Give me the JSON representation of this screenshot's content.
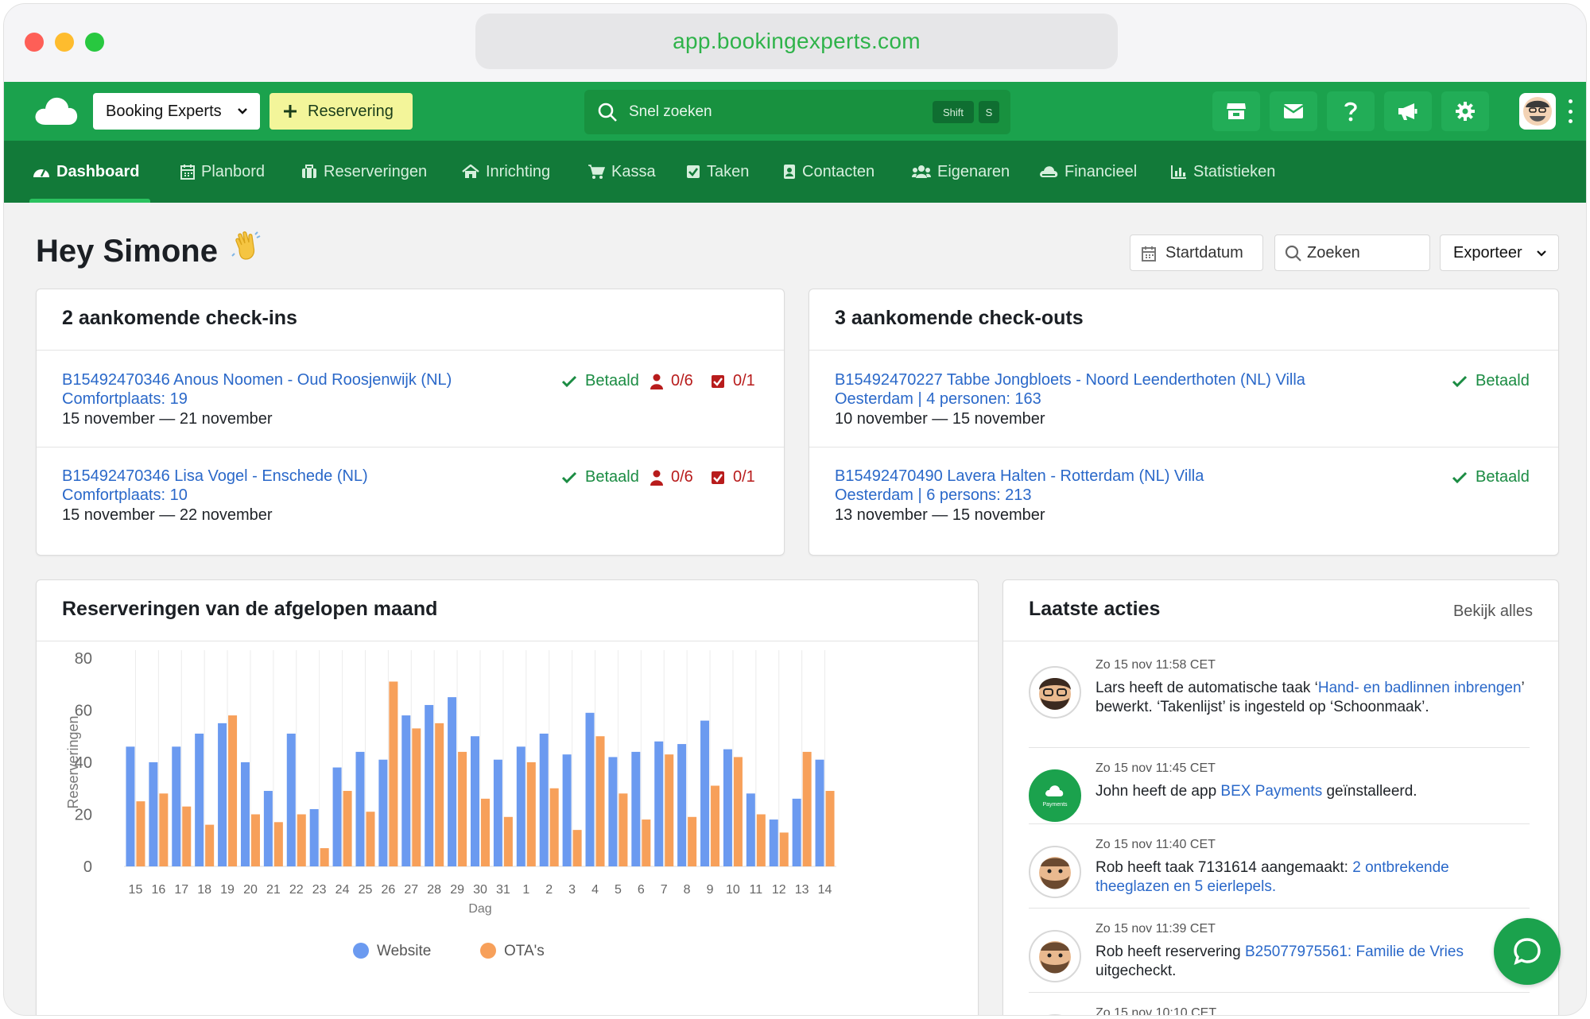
{
  "browser": {
    "url": "app.bookingexperts.com"
  },
  "topbar": {
    "account": "Booking Experts",
    "new_button": "Reservering",
    "search_placeholder": "Snel zoeken",
    "shortcut_keys": [
      "Shift",
      "S"
    ],
    "icons": [
      "store-icon",
      "envelope-icon",
      "question-icon",
      "megaphone-icon",
      "gear-icon"
    ]
  },
  "nav": {
    "items": [
      {
        "label": "Dashboard",
        "icon": "dashboard-icon",
        "active": true
      },
      {
        "label": "Planbord",
        "icon": "calendar-icon"
      },
      {
        "label": "Reserveringen",
        "icon": "suitcase-icon"
      },
      {
        "label": "Inrichting",
        "icon": "home-icon"
      },
      {
        "label": "Kassa",
        "icon": "cart-icon"
      },
      {
        "label": "Taken",
        "icon": "checkbox-icon"
      },
      {
        "label": "Contacten",
        "icon": "contact-card-icon"
      },
      {
        "label": "Eigenaren",
        "icon": "users-icon"
      },
      {
        "label": "Financieel",
        "icon": "cloud-icon"
      },
      {
        "label": "Statistieken",
        "icon": "bar-chart-icon"
      }
    ]
  },
  "header": {
    "greeting": "Hey Simone",
    "date_button": "Startdatum",
    "search_placeholder": "Zoeken",
    "export_button": "Exporteer"
  },
  "checkins": {
    "title": "2 aankomende check-ins",
    "rows": [
      {
        "link": "B15492470346 Anous Noomen - Oud Roosjenwijk (NL) Comfortplaats: 19",
        "dates": "15 november — 21 november",
        "status": "Betaald",
        "guests": "0/6",
        "tasks": "0/1"
      },
      {
        "link": "B15492470346 Lisa Vogel - Enschede (NL) Comfortplaats: 10",
        "dates": "15 november — 22 november",
        "status": "Betaald",
        "guests": "0/6",
        "tasks": "0/1"
      }
    ]
  },
  "checkouts": {
    "title": "3 aankomende check-outs",
    "rows": [
      {
        "link": "B15492470227 Tabbe Jongbloets - Noord Leenderthoten (NL) Villa Oesterdam | 4 personen: 163",
        "dates": "10 november — 15 november",
        "status": "Betaald"
      },
      {
        "link": "B15492470490 Lavera Halten - Rotterdam (NL) Villa Oesterdam | 6 persons: 213",
        "dates": "13 november — 15 november",
        "status": "Betaald"
      }
    ]
  },
  "chart_card": {
    "title": "Reserveringen van de afgelopen maand"
  },
  "chart_data": {
    "type": "bar",
    "xlabel": "Dag",
    "ylabel": "Reserveringen",
    "ylim": [
      0,
      80
    ],
    "yticks": [
      0,
      20,
      40,
      60,
      80
    ],
    "grid": true,
    "legend": "bottom",
    "categories": [
      "15",
      "16",
      "17",
      "18",
      "19",
      "20",
      "21",
      "22",
      "23",
      "24",
      "25",
      "26",
      "27",
      "28",
      "29",
      "30",
      "31",
      "1",
      "2",
      "3",
      "4",
      "5",
      "6",
      "7",
      "8",
      "9",
      "10",
      "11",
      "12",
      "13",
      "14"
    ],
    "series": [
      {
        "name": "Website",
        "color": "#6b9af0",
        "values": [
          46,
          40,
          46,
          51,
          55,
          40,
          29,
          51,
          22,
          38,
          44,
          41,
          58,
          62,
          65,
          50,
          41,
          46,
          51,
          43,
          59,
          42,
          44,
          48,
          47,
          56,
          45,
          28,
          18,
          26,
          41
        ]
      },
      {
        "name": "OTA's",
        "color": "#f7a05a",
        "values": [
          25,
          28,
          23,
          16,
          58,
          20,
          17,
          20,
          7,
          29,
          21,
          71,
          53,
          55,
          44,
          26,
          19,
          40,
          30,
          14,
          50,
          28,
          18,
          43,
          19,
          31,
          42,
          20,
          13,
          44,
          29
        ]
      }
    ]
  },
  "activities": {
    "title": "Laatste acties",
    "view_all": "Bekijk alles",
    "items": [
      {
        "time": "Zo 15 nov 11:58 CET",
        "before": "Lars heeft de automatische taak ‘",
        "link": "Hand- en badlinnen inbrengen",
        "after": "’ bewerkt. ‘Takenlijst’ is ingesteld op ‘Schoonmaak’."
      },
      {
        "time": "Zo 15 nov 11:45 CET",
        "before": "John heeft de app ",
        "link": "BEX Payments",
        "after": " geïnstalleerd.",
        "avatar_label": "Payments"
      },
      {
        "time": "Zo 15 nov 11:40 CET",
        "before": "Rob heeft taak 7131614 aangemaakt: ",
        "link": "2 ontbrekende theeglazen en 5 eierlepels.",
        "after": ""
      },
      {
        "time": "Zo 15 nov 11:39 CET",
        "before": "Rob heeft reservering ",
        "link": "B25077975561: Familie de Vries",
        "after": " uitgecheckt."
      },
      {
        "time": "Zo 15 nov 10:10 CET",
        "before": "",
        "link": "",
        "after": ""
      }
    ]
  }
}
